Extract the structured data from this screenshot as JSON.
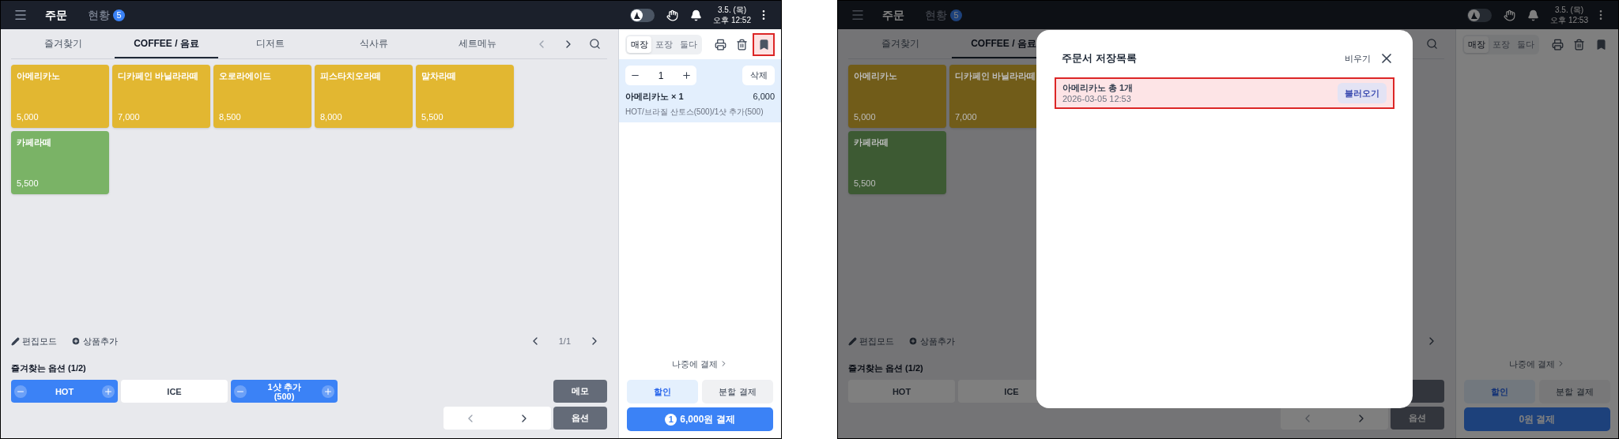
{
  "screens": [
    {
      "header": {
        "title": "주문",
        "status_tab": "현황",
        "status_count": "5",
        "dark_mode_on": false,
        "date": "3.5. (목)",
        "time": "오후 12:52"
      },
      "category_tabs": [
        {
          "label": "즐겨찾기",
          "selected": false
        },
        {
          "label": "COFFEE / 음료",
          "selected": true
        },
        {
          "label": "디저트",
          "selected": false
        },
        {
          "label": "식사류",
          "selected": false
        },
        {
          "label": "세트메뉴",
          "selected": false
        }
      ],
      "tab_arrows": true,
      "product_rows": [
        [
          {
            "name": "아메리카노",
            "price": "5,000",
            "color": "#e2b731"
          },
          {
            "name": "디카페인 바닐라라떼",
            "price": "7,000",
            "color": "#e2b731"
          },
          {
            "name": "오로라에이드",
            "price": "8,500",
            "color": "#e2b731"
          },
          {
            "name": "피스타치오라떼",
            "price": "8,000",
            "color": "#e2b731"
          },
          {
            "name": "말차라떼",
            "price": "5,500",
            "color": "#e2b731"
          }
        ],
        [
          {
            "name": "카페라떼",
            "price": "5,500",
            "color": "#7ab366"
          }
        ]
      ],
      "tools": {
        "edit_mode": "편집모드",
        "add_product": "상품추가"
      },
      "pager": {
        "page": "1/1"
      },
      "favorite_options": {
        "title": "즐겨찾는 옵션 (1/2)",
        "items": [
          {
            "kind": "stepper",
            "label": "HOT",
            "selected": true
          },
          {
            "kind": "toggle",
            "label": "ICE",
            "selected": false
          },
          {
            "kind": "stepper",
            "label": "1샷 추가",
            "sublabel": "(500)",
            "selected": true
          }
        ]
      },
      "memo_button": "메모",
      "option_button": "옵션",
      "order_types": [
        {
          "label": "매장",
          "selected": true
        },
        {
          "label": "포장",
          "selected": false
        },
        {
          "label": "둘다",
          "selected": false
        }
      ],
      "bookmark_highlighted": true,
      "cart": [
        {
          "quantity": "1",
          "delete": "삭제",
          "name": "아메리카노 × 1",
          "price": "6,000",
          "details": "HOT/브라질 산토스(500)/1샷 추가(500)"
        }
      ],
      "pay_later": "나중에 결제",
      "discount": "할인",
      "split": "분할 결제",
      "pay": {
        "count": "1",
        "label": "6,000원 결제"
      }
    },
    {
      "header": {
        "title": "주문",
        "status_tab": "현황",
        "status_count": "5",
        "dark_mode_on": false,
        "date": "3.5. (목)",
        "time": "오후 12:53"
      },
      "category_tabs": [
        {
          "label": "즐겨찾기",
          "selected": false
        },
        {
          "label": "COFFEE / 음료",
          "selected": true
        }
      ],
      "tab_arrows": false,
      "product_rows": [
        [
          {
            "name": "아메리카노",
            "price": "5,000",
            "color": "#715c19"
          },
          {
            "name": "디카페인 바닐라라떼",
            "price": "7,000",
            "color": "#715c19"
          }
        ],
        [
          {
            "name": "카페라떼",
            "price": "5,500",
            "color": "#3d5a33"
          }
        ]
      ],
      "tools": {
        "edit_mode": "편집모드",
        "add_product": "상품추가"
      },
      "favorite_options": {
        "title": "즐겨찾는 옵션 (1/2)",
        "items": [
          {
            "kind": "stepper",
            "label": "HOT",
            "selected": false
          },
          {
            "kind": "toggle",
            "label": "ICE",
            "selected": false
          }
        ]
      },
      "option_button": "옵션",
      "order_types": [
        {
          "label": "매장",
          "selected": true
        },
        {
          "label": "포장",
          "selected": false
        },
        {
          "label": "둘다",
          "selected": false
        }
      ],
      "bookmark_highlighted": false,
      "pay_later": "나중에 결제",
      "discount": "할인",
      "split": "분할 결제",
      "pay": {
        "label": "0원 결제"
      },
      "modal": {
        "title": "주문서 저장목록",
        "clear": "비우기",
        "items": [
          {
            "title": "아메리카노 총 1개",
            "date": "2026-03-05 12:53",
            "load": "불러오기",
            "highlighted": true
          }
        ]
      }
    }
  ]
}
